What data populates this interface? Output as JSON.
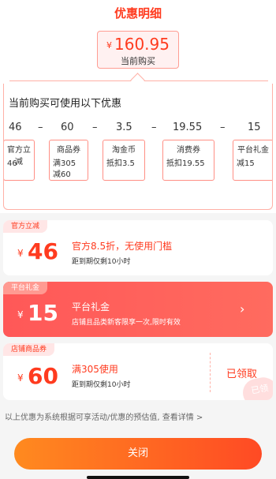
{
  "header": {
    "title": "优惠明细"
  },
  "total": {
    "currency": "¥",
    "amount": "160.95",
    "caption": "当前购买"
  },
  "breakdown": {
    "title": "当前购买可使用以下优惠",
    "formula": [
      "46",
      "–",
      "60",
      "–",
      "3.5",
      "–",
      "19.55",
      "–",
      "15"
    ],
    "chips": [
      {
        "name": "官方立减",
        "detail": "46"
      },
      {
        "name": "商品券",
        "detail": "满305 减60"
      },
      {
        "name": "淘金币",
        "detail": "抵扣3.5"
      },
      {
        "name": "消费券",
        "detail": "抵扣19.55"
      },
      {
        "name": "平台礼金",
        "detail": "减15"
      }
    ]
  },
  "coupons": [
    {
      "tag": "官方立减",
      "currency": "¥",
      "amount": "46",
      "description": "官方8.5折，无使用门槛",
      "subtext": "距到期仅剩10小时"
    },
    {
      "tag": "平台礼金",
      "currency": "¥",
      "amount": "15",
      "description": "平台礼金",
      "subtext": "店铺且品类新客限享一次,限时有效"
    },
    {
      "tag": "店铺商品券",
      "currency": "¥",
      "amount": "60",
      "description": "满305使用",
      "subtext": "距到期仅剩10小时",
      "status": "已领取",
      "stamp": "已领"
    }
  ],
  "footnote": "以上优惠为系统根据可享活动/优惠的预估值, 查看详情 >",
  "actions": {
    "close_label": "关闭"
  },
  "colors": {
    "accent": "#ff3b1f",
    "button_start": "#ff8a1f",
    "button_end": "#ff4a24"
  }
}
